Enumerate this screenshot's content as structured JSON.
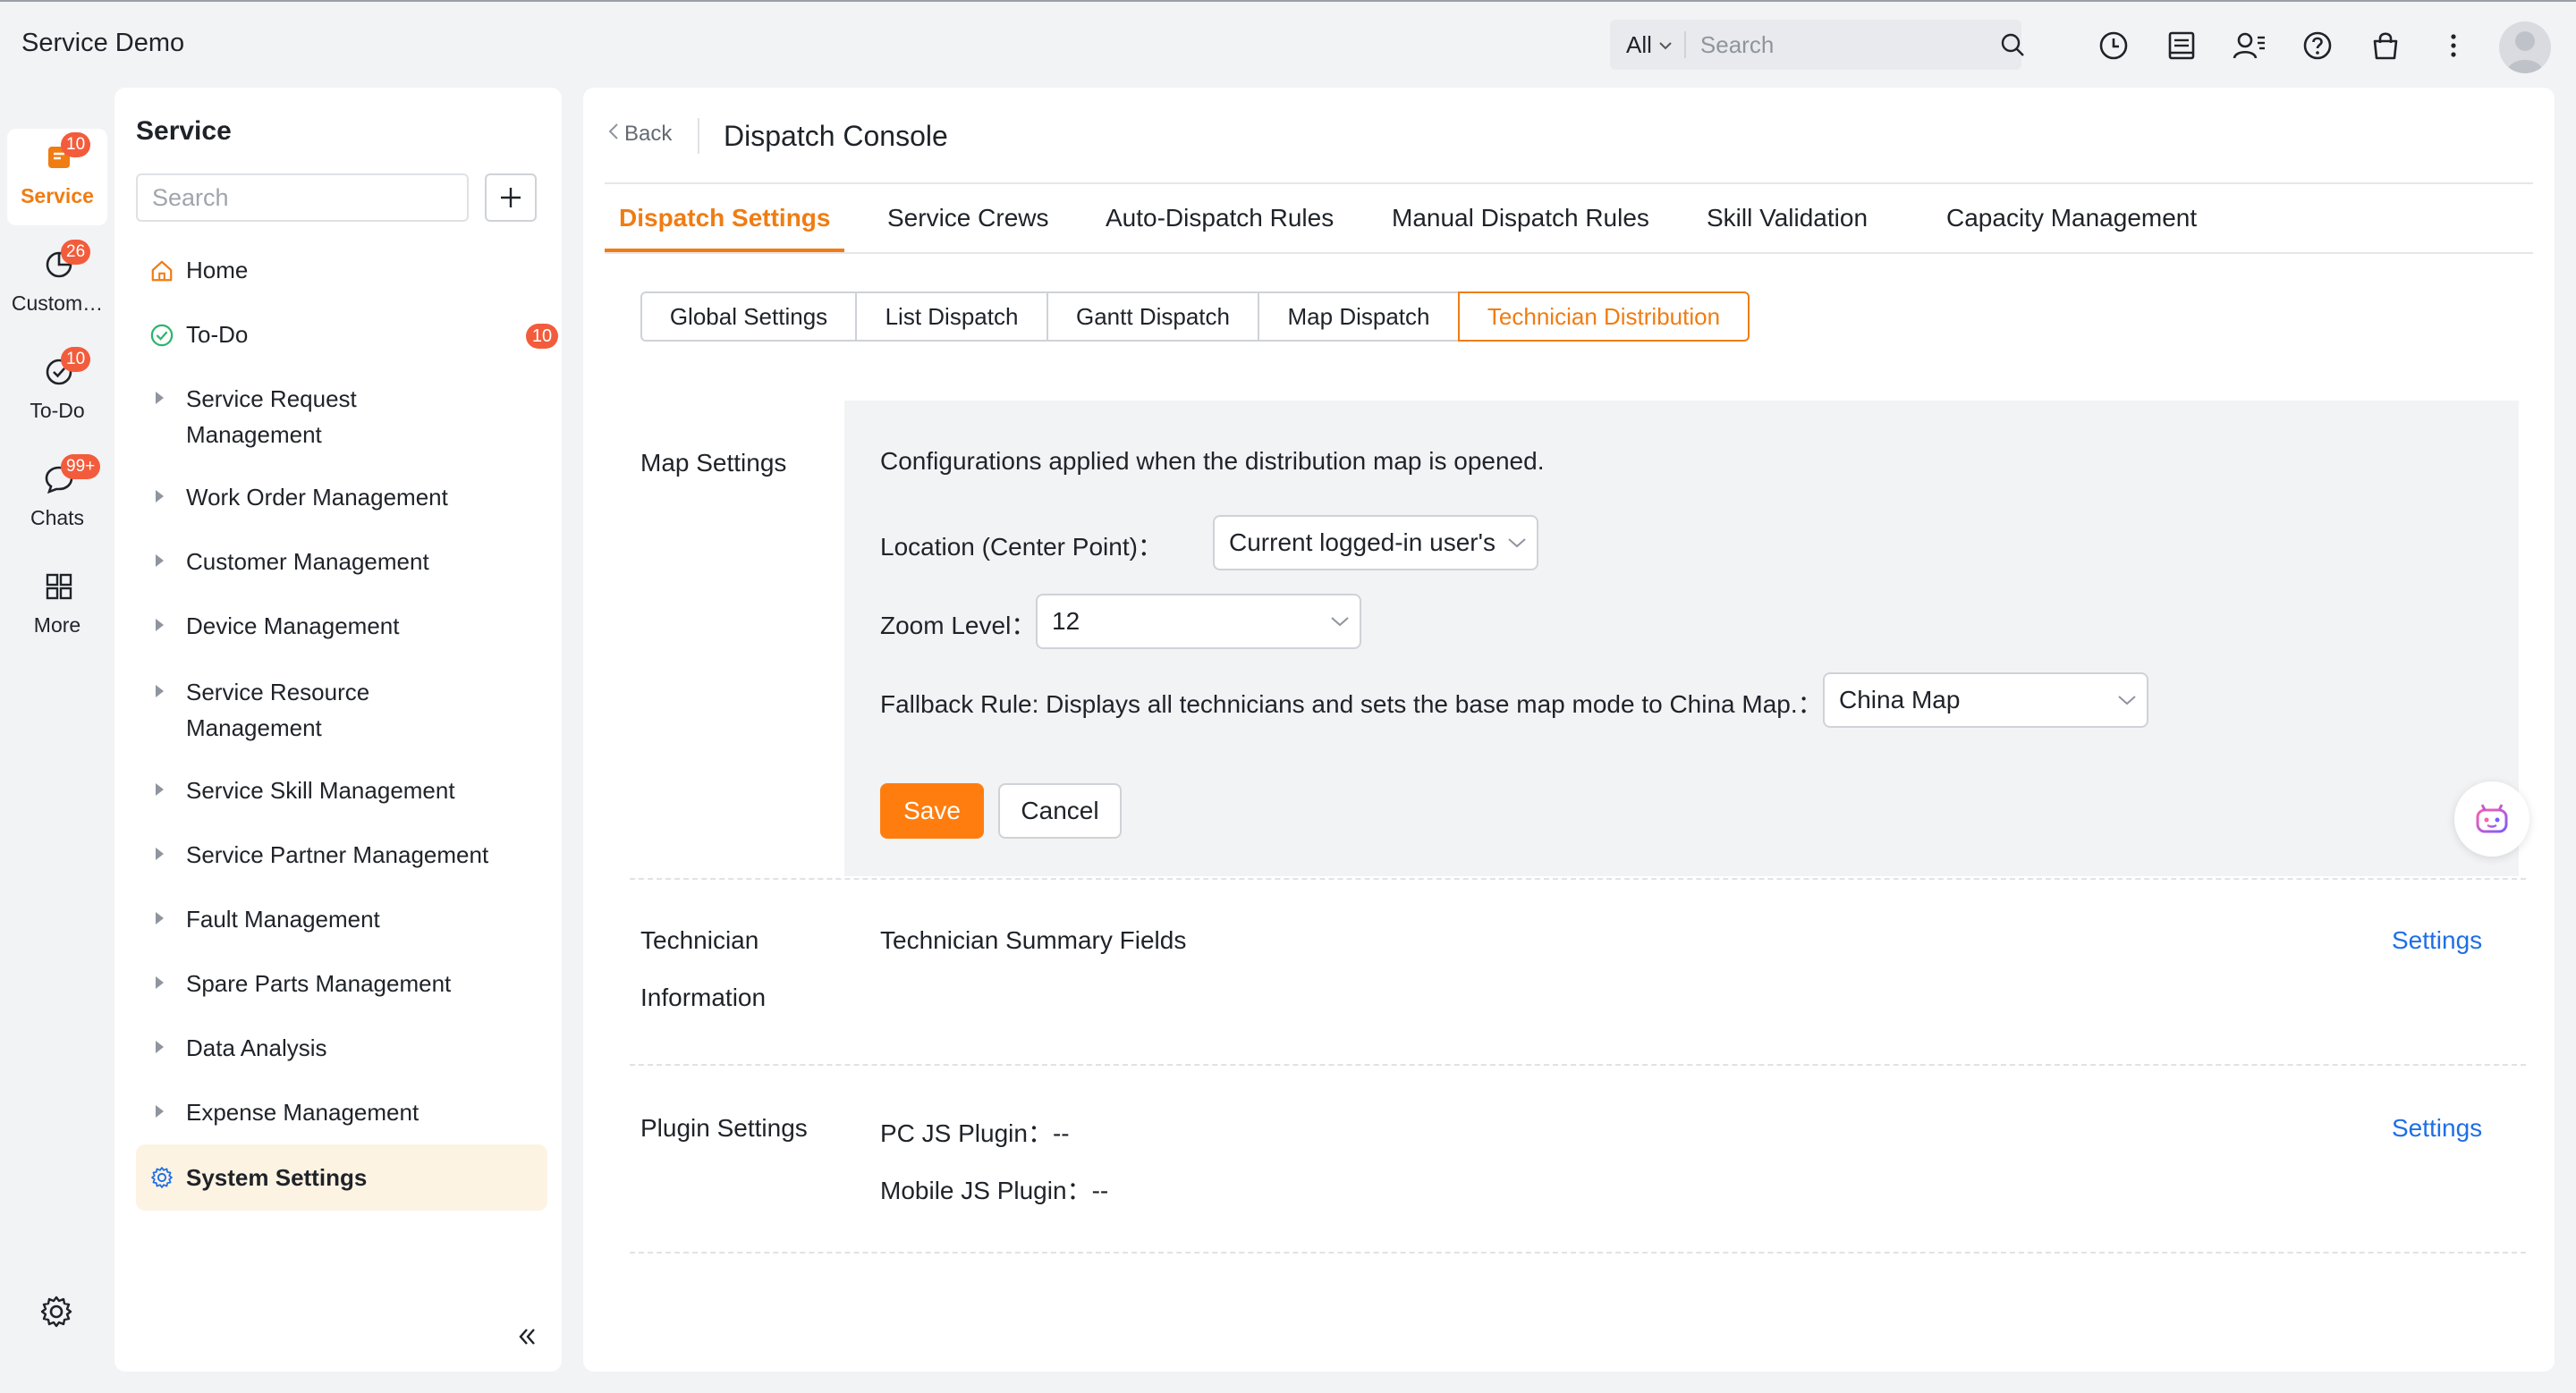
{
  "app": {
    "title": "Service Demo"
  },
  "topbar": {
    "scope": "All",
    "search_placeholder": "Search",
    "icons": [
      "clock-icon",
      "notes-icon",
      "contacts-icon",
      "help-icon",
      "bag-icon",
      "more-vertical-icon"
    ]
  },
  "rail": {
    "items": [
      {
        "label": "Service",
        "badge": "10",
        "icon": "service-icon",
        "active": true
      },
      {
        "label": "Custom…",
        "badge": "26",
        "icon": "pie-chart-icon"
      },
      {
        "label": "To-Do",
        "badge": "10",
        "icon": "check-circle-icon"
      },
      {
        "label": "Chats",
        "badge": "99+",
        "icon": "chat-bubble-icon"
      },
      {
        "label": "More",
        "icon": "grid-icon"
      }
    ]
  },
  "sidebar": {
    "title": "Service",
    "search_placeholder": "Search",
    "items": [
      {
        "label": "Home"
      },
      {
        "label": "To-Do",
        "badge": "10"
      },
      {
        "label": "Service Request Management"
      },
      {
        "label": "Work Order Management"
      },
      {
        "label": "Customer Management"
      },
      {
        "label": "Device Management"
      },
      {
        "label": "Service Resource Management"
      },
      {
        "label": "Service Skill Management"
      },
      {
        "label": "Service Partner Management"
      },
      {
        "label": "Fault Management"
      },
      {
        "label": "Spare Parts Management"
      },
      {
        "label": "Data Analysis"
      },
      {
        "label": "Expense Management"
      },
      {
        "label": "System Settings",
        "active": true
      }
    ]
  },
  "main": {
    "back_label": "Back",
    "title": "Dispatch Console",
    "tabs": [
      {
        "label": "Dispatch Settings",
        "active": true
      },
      {
        "label": "Service Crews"
      },
      {
        "label": "Auto-Dispatch Rules"
      },
      {
        "label": "Manual Dispatch Rules"
      },
      {
        "label": "Skill Validation"
      },
      {
        "label": "Capacity Management"
      }
    ],
    "subtabs": [
      {
        "label": "Global Settings"
      },
      {
        "label": "List Dispatch"
      },
      {
        "label": "Gantt Dispatch"
      },
      {
        "label": "Map Dispatch"
      },
      {
        "label": "Technician Distribution",
        "active": true
      }
    ],
    "map_settings": {
      "label": "Map Settings",
      "description": "Configurations applied when the distribution map is opened.",
      "location_label": "Location (Center Point)：",
      "location_value": "Current logged-in user's",
      "zoom_label": "Zoom Level：",
      "zoom_value": "12",
      "fallback_label": "Fallback Rule: Displays all technicians and sets the base map mode to China Map.：",
      "fallback_value": "China Map",
      "save_label": "Save",
      "cancel_label": "Cancel"
    },
    "technician_info": {
      "label_line1": "Technician",
      "label_line2": "Information",
      "field": "Technician Summary Fields",
      "settings_label": "Settings"
    },
    "plugin_settings": {
      "label": "Plugin Settings",
      "pc_label": "PC JS Plugin：",
      "pc_value": "--",
      "mobile_label": "Mobile JS Plugin：",
      "mobile_value": "--",
      "settings_label": "Settings"
    }
  },
  "colors": {
    "accent": "#f07c12",
    "link": "#1e6fe6",
    "badge": "#f25c3c",
    "save": "#ff7d0f"
  }
}
